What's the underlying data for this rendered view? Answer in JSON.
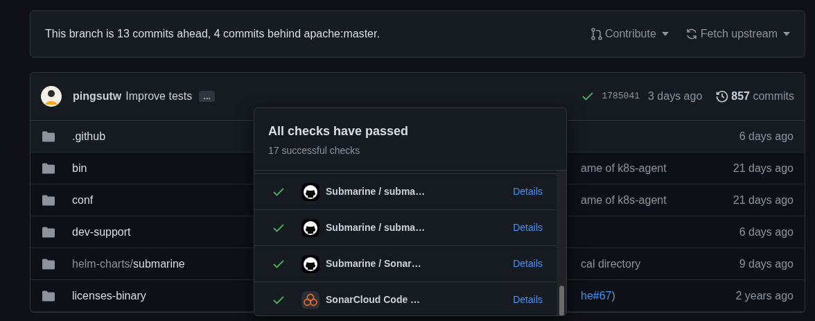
{
  "banner": {
    "text": "This branch is 13 commits ahead, 4 commits behind apache:master.",
    "buttons": [
      {
        "label": "Contribute",
        "kind": "merge"
      },
      {
        "label": "Fetch upstream",
        "kind": "sync"
      }
    ]
  },
  "latest_commit": {
    "author": "pingsutw",
    "message": "Improve tests",
    "more": "…",
    "sha": "1785041",
    "time": "3 days ago",
    "commit_count": "857",
    "commit_label": "commits"
  },
  "files": [
    {
      "name": ".github",
      "time": "6 days ago",
      "selected": true
    },
    {
      "name": "bin",
      "message": [
        {
          "text": "ame of k8s-agent",
          "link": false
        }
      ],
      "time": "21 days ago",
      "selected": false
    },
    {
      "name": "conf",
      "message": [
        {
          "text": "ame of k8s-agent",
          "link": false
        }
      ],
      "time": "21 days ago",
      "selected": false
    },
    {
      "name": "dev-support",
      "time": "6 days ago",
      "selected": false
    },
    {
      "prefix": "helm-charts/",
      "name": "submarine",
      "message": [
        {
          "text": "cal directory",
          "link": false
        }
      ],
      "time": "9 days ago",
      "selected": false
    },
    {
      "name": "licenses-binary",
      "message": [
        {
          "text": "he#67",
          "link": true
        },
        {
          "text": ")",
          "link": false
        }
      ],
      "time": "2 years ago",
      "selected": false
    }
  ],
  "checks_popover": {
    "title": "All checks have passed",
    "subtitle": "17 successful checks",
    "checks": [
      {
        "kind": "github",
        "name": "Submarine / subma…",
        "link": "Details"
      },
      {
        "kind": "github",
        "name": "Submarine / subma…",
        "link": "Details"
      },
      {
        "kind": "github",
        "name": "Submarine / Sonar…",
        "link": "Details"
      },
      {
        "kind": "sonarcloud",
        "name": "SonarCloud Code …",
        "link": "Details"
      }
    ]
  }
}
